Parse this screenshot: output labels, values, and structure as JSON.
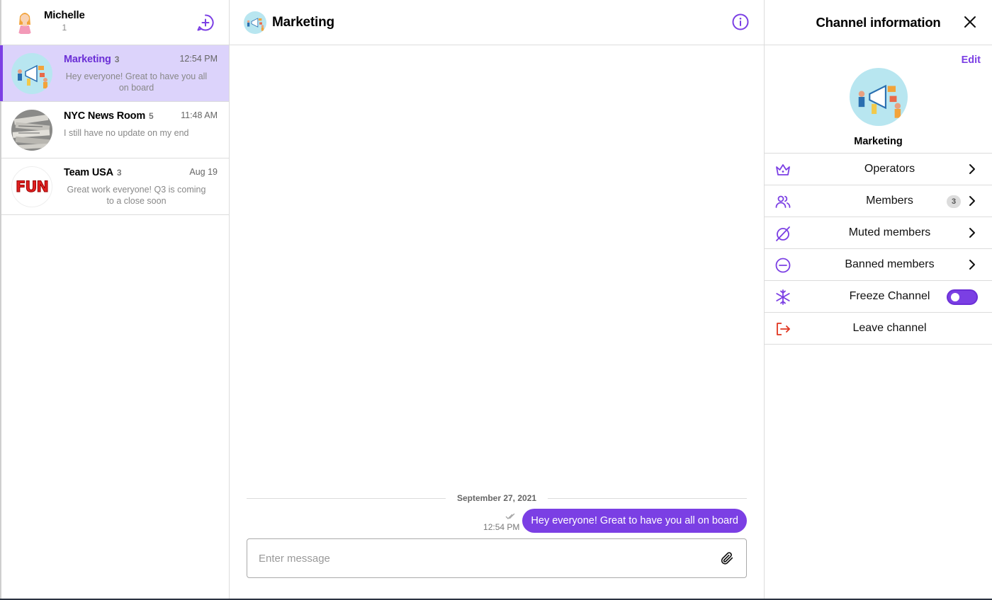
{
  "user": {
    "name": "Michelle",
    "sub": "1"
  },
  "channels": [
    {
      "name": "Marketing",
      "count": "3",
      "time": "12:54 PM",
      "message": "Hey everyone! Great to have you all on board",
      "active": true
    },
    {
      "name": "NYC News Room",
      "count": "5",
      "time": "11:48 AM",
      "message": "I still have no update on my end",
      "active": false
    },
    {
      "name": "Team USA",
      "count": "3",
      "time": "Aug 19",
      "message": "Great work everyone! Q3 is coming to a close soon",
      "active": false,
      "avatar_text": "FUN"
    }
  ],
  "conversation": {
    "title": "Marketing",
    "date_separator": "September 27, 2021",
    "messages": [
      {
        "text": "Hey everyone! Great to have you all on board",
        "time": "12:54 PM",
        "status": "read"
      }
    ],
    "input_placeholder": "Enter message"
  },
  "channel_info": {
    "title": "Channel information",
    "edit_label": "Edit",
    "channel_name": "Marketing",
    "menu": {
      "operators": "Operators",
      "members": "Members",
      "members_count": "3",
      "muted": "Muted members",
      "banned": "Banned members",
      "freeze": "Freeze Channel",
      "freeze_on": true,
      "leave": "Leave channel"
    }
  },
  "colors": {
    "accent": "#7b3fe4",
    "active_bg": "#dcd3fb",
    "leave": "#e0341f"
  }
}
